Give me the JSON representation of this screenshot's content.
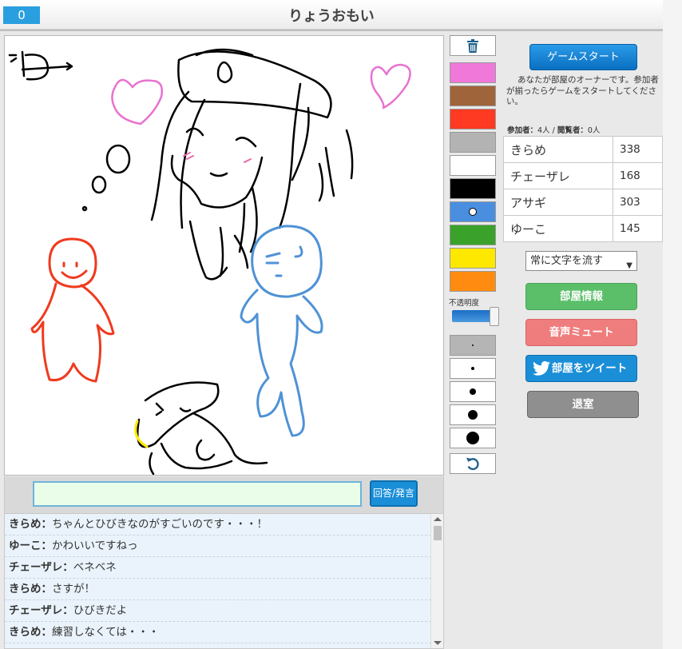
{
  "header": {
    "round": "0",
    "title": "りょうおもい"
  },
  "answer": {
    "input_value": "",
    "submit_label": "回答/発言"
  },
  "chat": [
    {
      "name": "きらめ：",
      "message": "ちゃんとひびきなのがすごいのです・・・！"
    },
    {
      "name": "ゆーこ：",
      "message": "かわいいですねっ"
    },
    {
      "name": "チェーザレ：",
      "message": "ベネベネ"
    },
    {
      "name": "きらめ：",
      "message": "さすが！"
    },
    {
      "name": "チェーザレ：",
      "message": "ひびきだよ"
    },
    {
      "name": "きらめ：",
      "message": "練習しなくては・・・"
    }
  ],
  "tools": {
    "colors": [
      "#f078d8",
      "#a0643a",
      "#ff3a22",
      "#b3b3b3",
      "#ffffff",
      "#000000",
      "#4a8ee0",
      "#3aa22a",
      "#ffe800",
      "#ff8c10"
    ],
    "selected_color_index": 6,
    "opacity_label": "不透明度",
    "opacity": 0.9,
    "brush_sizes": [
      2,
      4,
      8,
      12,
      16
    ],
    "selected_size_index": 0
  },
  "panel": {
    "start_label": "ゲームスタート",
    "owner_note": "あなたが部屋のオーナーです。参加者が揃ったらゲームをスタートしてください。",
    "participants_label": "参加者：",
    "participants_value": "4人",
    "separator": " / ",
    "viewers_label": "閲覧者：",
    "viewers_value": "0人",
    "players": [
      {
        "name": "きらめ",
        "score": "338"
      },
      {
        "name": "チェーザレ",
        "score": "168"
      },
      {
        "name": "アサギ",
        "score": "303"
      },
      {
        "name": "ゆーこ",
        "score": "145"
      }
    ],
    "stream_option": "常に文字を流す",
    "room_info_label": "部屋情報",
    "mute_label": "音声ミュート",
    "tweet_label": "部屋をツイート",
    "leave_label": "退室"
  }
}
